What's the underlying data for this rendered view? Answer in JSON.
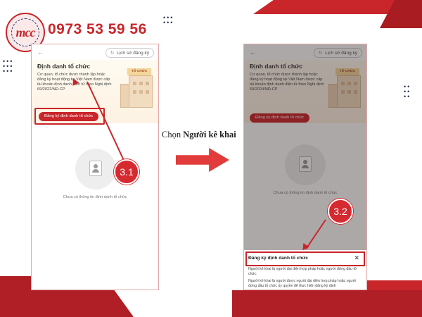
{
  "brand": {
    "logo_text": "mcc",
    "phone": "0973 53 59 56",
    "accent_color": "#c8262b"
  },
  "instruction": {
    "prefix": "Chọn ",
    "emphasis": "Người kê khai"
  },
  "screen1": {
    "history_button": "Lịch sử đăng ký",
    "title": "Định danh tổ chức",
    "description": "Cơ quan, tổ chức được thành lập hoặc đăng ký hoạt động tại Việt Nam được cấp tài khoản định danh điện tử theo Nghị định 69/2022/NĐ-CP",
    "building_sign": "TỔ CHỨC",
    "register_button": "Đăng ký định danh tổ chức",
    "empty_text": "Chưa có thông tin định danh tổ chức",
    "step_badge": "3.1"
  },
  "screen2": {
    "history_button": "Lịch sử đăng ký",
    "title": "Định danh tổ chức",
    "description": "Cơ quan, tổ chức được thành lập hoặc đăng ký hoạt động tại Việt Nam được cấp tài khoản định danh điện tử theo Nghị định 69/2024/NĐ-CP",
    "building_sign": "TỔ CHỨC",
    "register_button": "Đăng ký định danh tổ chức",
    "empty_text": "Chưa có thông tin định danh tổ chức",
    "step_badge": "3.2",
    "sheet": {
      "title": "Đăng ký định danh tổ chức",
      "close": "✕",
      "paragraph1": "Người kê khai là người đại diện hợp pháp hoặc người đứng đầu tổ chức",
      "paragraph2": "Người kê khai là người được người đại diện hợp pháp hoặc người đứng đầu tổ chức ủy quyền để thực hiện đăng ký định"
    }
  }
}
